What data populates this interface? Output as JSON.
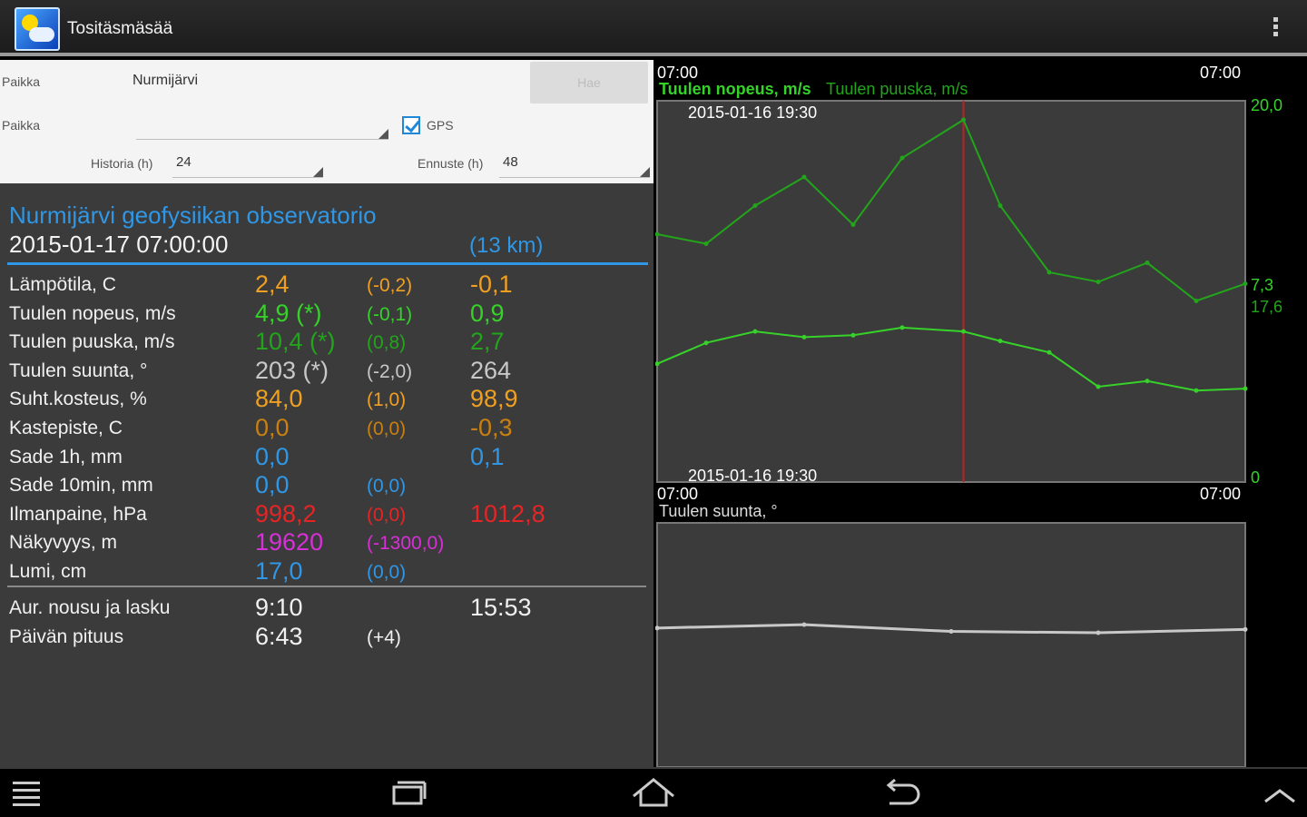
{
  "app": {
    "title": "Tositäsmäsää",
    "icon": "weather-app-icon",
    "menu_icon": "overflow-menu-icon"
  },
  "form": {
    "place_label": "Paikka",
    "place_value": "Nurmijärvi",
    "search_button": "Hae",
    "place_label2": "Paikka",
    "place_select_value": "",
    "gps_label": "GPS",
    "gps_checked": true,
    "history_label": "Historia (h)",
    "history_value": "24",
    "forecast_label": "Ennuste (h)",
    "forecast_value": "48"
  },
  "station": {
    "name": "Nurmijärvi geofysiikan observatorio",
    "time": "2015-01-17 07:00:00",
    "distance": "(13 km)"
  },
  "colors": {
    "accent_blue": "#2f97e6",
    "orange": "#f0a020",
    "green": "#36d22a",
    "dark_green": "#22a51b",
    "gray": "#c8c8c8",
    "red": "#e52525",
    "magenta": "#d730d7",
    "sky": "#2f97e6"
  },
  "measurements": [
    {
      "label": "Lämpötila, C",
      "value": "2,4",
      "change": "(-0,2)",
      "extra": "-0,1",
      "color": "#f0a020"
    },
    {
      "label": "Tuulen nopeus, m/s",
      "value": "4,9 (*)",
      "change": "(-0,1)",
      "extra": "0,9",
      "color": "#36d22a"
    },
    {
      "label": "Tuulen puuska, m/s",
      "value": "10,4 (*)",
      "change": "(0,8)",
      "extra": "2,7",
      "color": "#22a51b"
    },
    {
      "label": "Tuulen suunta, °",
      "value": "203 (*)",
      "change": "(-2,0)",
      "extra": "264",
      "color": "#c8c8c8"
    },
    {
      "label": "Suht.kosteus, %",
      "value": "84,0",
      "change": "(1,0)",
      "extra": "98,9",
      "color": "#f0a020"
    },
    {
      "label": "Kastepiste, C",
      "value": "0,0",
      "change": "(0,0)",
      "extra": "-0,3",
      "color": "#c98010"
    },
    {
      "label": "Sade 1h, mm",
      "value": "0,0",
      "change": "",
      "extra": "0,1",
      "color": "#2f97e6"
    },
    {
      "label": "Sade 10min, mm",
      "value": "0,0",
      "change": "(0,0)",
      "extra": "",
      "color": "#2f97e6"
    },
    {
      "label": "Ilmanpaine, hPa",
      "value": "998,2",
      "change": "(0,0)",
      "extra": "1012,8",
      "color": "#e52525"
    },
    {
      "label": "Näkyvyys, m",
      "value": "19620",
      "change": "(-1300,0)",
      "extra": "",
      "color": "#d730d7"
    },
    {
      "label": "Lumi, cm",
      "value": "17,0",
      "change": "(0,0)",
      "extra": "",
      "color": "#2f97e6"
    }
  ],
  "sun": [
    {
      "label": "Aur. nousu ja lasku",
      "value": "9:10",
      "change": "",
      "extra": "15:53"
    },
    {
      "label": "Päivän pituus",
      "value": "6:43",
      "change": "(+4)",
      "extra": ""
    }
  ],
  "chart_data": [
    {
      "type": "line",
      "title": "",
      "series": [
        {
          "name": "Tuulen nopeus, m/s",
          "color": "#36d22a",
          "x": [
            "2015-01-16 07:00",
            "2015-01-16 09:00",
            "2015-01-16 11:00",
            "2015-01-16 13:00",
            "2015-01-16 15:00",
            "2015-01-16 17:00",
            "2015-01-16 19:30",
            "2015-01-16 21:00",
            "2015-01-16 23:00",
            "2015-01-17 01:00",
            "2015-01-17 03:00",
            "2015-01-17 05:00",
            "2015-01-17 07:00"
          ],
          "values": [
            6.2,
            7.3,
            7.9,
            7.6,
            7.7,
            8.1,
            7.9,
            7.4,
            6.8,
            5.0,
            5.3,
            4.8,
            4.9
          ]
        },
        {
          "name": "Tuulen puuska, m/s",
          "color": "#22a51b",
          "x": [
            "2015-01-16 07:00",
            "2015-01-16 09:00",
            "2015-01-16 11:00",
            "2015-01-16 13:00",
            "2015-01-16 15:00",
            "2015-01-16 17:00",
            "2015-01-16 19:30",
            "2015-01-16 21:00",
            "2015-01-16 23:00",
            "2015-01-17 01:00",
            "2015-01-17 03:00",
            "2015-01-17 05:00",
            "2015-01-17 07:00"
          ],
          "values": [
            13.0,
            12.5,
            14.5,
            16.0,
            13.5,
            17.0,
            19.0,
            14.5,
            11.0,
            10.5,
            11.5,
            9.5,
            10.4
          ]
        }
      ],
      "ylim": [
        0,
        20
      ],
      "y_labels": {
        "top": "20,0",
        "current_speed": "7,3",
        "current_gust": "17,6",
        "bottom": "0"
      },
      "x_start_label": "07:00",
      "x_end_label": "07:00",
      "marker_label": "2015-01-16 19:30",
      "grid": false
    },
    {
      "type": "line",
      "series": [
        {
          "name": "Tuulen suunta, °",
          "color": "#c8c8c8",
          "x": [
            "2015-01-16 07:00",
            "2015-01-16 13:00",
            "2015-01-16 19:00",
            "2015-01-17 01:00",
            "2015-01-17 07:00"
          ],
          "values": [
            205,
            210,
            200,
            198,
            203
          ]
        }
      ],
      "x_start_label": "07:00",
      "x_end_label": "07:00"
    }
  ],
  "nav": {
    "menu": "menu-icon",
    "recents": "recent-apps-icon",
    "home": "home-icon",
    "back": "back-icon",
    "up": "chevron-up-icon"
  }
}
